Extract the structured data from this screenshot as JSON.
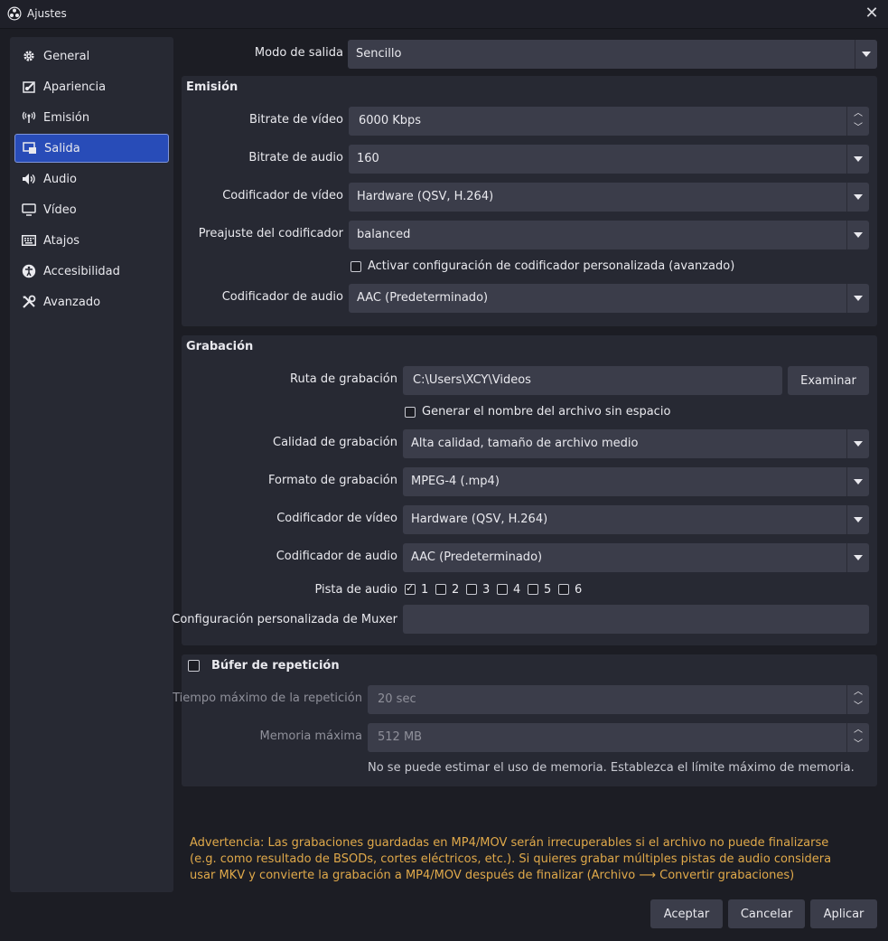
{
  "window": {
    "title": "Ajustes"
  },
  "sidebar": {
    "items": [
      {
        "label": "General",
        "icon": "gear-icon"
      },
      {
        "label": "Apariencia",
        "icon": "appearance-icon"
      },
      {
        "label": "Emisión",
        "icon": "broadcast-icon"
      },
      {
        "label": "Salida",
        "icon": "output-icon",
        "active": true
      },
      {
        "label": "Audio",
        "icon": "speaker-icon"
      },
      {
        "label": "Vídeo",
        "icon": "monitor-icon"
      },
      {
        "label": "Atajos",
        "icon": "keyboard-icon"
      },
      {
        "label": "Accesibilidad",
        "icon": "accessibility-icon"
      },
      {
        "label": "Avanzado",
        "icon": "tools-icon"
      }
    ]
  },
  "output_mode": {
    "label": "Modo de salida",
    "value": "Sencillo"
  },
  "streaming": {
    "title": "Emisión",
    "video_bitrate": {
      "label": "Bitrate de vídeo",
      "value": "6000 Kbps"
    },
    "audio_bitrate": {
      "label": "Bitrate de audio",
      "value": "160"
    },
    "video_encoder": {
      "label": "Codificador de vídeo",
      "value": "Hardware (QSV, H.264)"
    },
    "encoder_preset": {
      "label": "Preajuste del codificador",
      "value": "balanced"
    },
    "custom_encoder_check": {
      "label": "Activar configuración de codificador personalizada (avanzado)",
      "checked": false
    },
    "audio_encoder": {
      "label": "Codificador de audio",
      "value": "AAC (Predeterminado)"
    }
  },
  "recording": {
    "title": "Grabación",
    "path": {
      "label": "Ruta de grabación",
      "value": "C:\\Users\\XCY\\Videos",
      "browse": "Examinar"
    },
    "no_space_check": {
      "label": "Generar el nombre del archivo sin espacio",
      "checked": false
    },
    "quality": {
      "label": "Calidad de grabación",
      "value": "Alta calidad, tamaño de archivo medio"
    },
    "format": {
      "label": "Formato de grabación",
      "value": "MPEG-4 (.mp4)"
    },
    "video_encoder": {
      "label": "Codificador de vídeo",
      "value": "Hardware (QSV, H.264)"
    },
    "audio_encoder": {
      "label": "Codificador de audio",
      "value": "AAC (Predeterminado)"
    },
    "audio_track": {
      "label": "Pista de audio",
      "tracks": [
        "1",
        "2",
        "3",
        "4",
        "5",
        "6"
      ],
      "checked": [
        true,
        false,
        false,
        false,
        false,
        false
      ]
    },
    "muxer": {
      "label": "Configuración personalizada de Muxer",
      "value": ""
    }
  },
  "replay_buffer": {
    "title": "Búfer de repetición",
    "enabled": false,
    "max_time": {
      "label": "Tiempo máximo de la repetición",
      "value": "20 sec"
    },
    "max_memory": {
      "label": "Memoria máxima",
      "value": "512 MB"
    },
    "note": "No se puede estimar el uso de memoria. Establezca el límite máximo de memoria."
  },
  "warning": "Advertencia: Las grabaciones guardadas en MP4/MOV serán irrecuperables si el archivo no puede finalizarse (e.g. como resultado de BSODs, cortes eléctricos, etc.). Si quieres grabar múltiples pistas de audio considera usar MKV y convierte la grabación a MP4/MOV después de finalizar (Archivo ⟶ Convertir grabaciones)",
  "footer": {
    "accept": "Aceptar",
    "cancel": "Cancelar",
    "apply": "Aplicar"
  },
  "colors": {
    "accent": "#284cb8",
    "warning": "#e0a94a",
    "background": "#1c1d24",
    "panel": "#272933",
    "control": "#3b3d4a"
  }
}
